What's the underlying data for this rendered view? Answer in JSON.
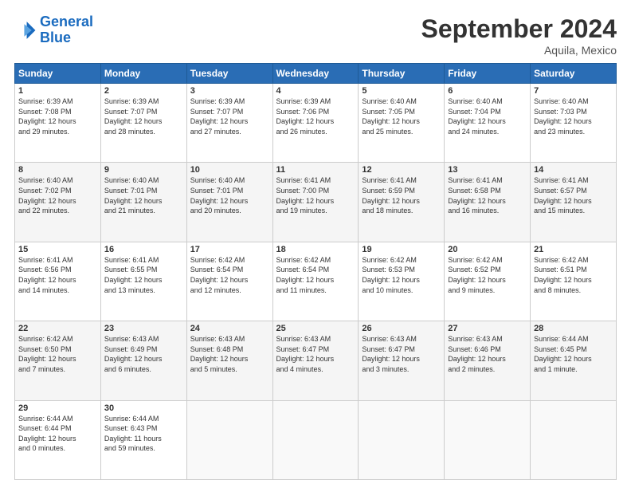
{
  "logo": {
    "line1": "General",
    "line2": "Blue"
  },
  "title": "September 2024",
  "location": "Aquila, Mexico",
  "header_days": [
    "Sunday",
    "Monday",
    "Tuesday",
    "Wednesday",
    "Thursday",
    "Friday",
    "Saturday"
  ],
  "weeks": [
    [
      {
        "num": "1",
        "rise": "6:39 AM",
        "set": "7:08 PM",
        "daylight": "12 hours and 29 minutes."
      },
      {
        "num": "2",
        "rise": "6:39 AM",
        "set": "7:07 PM",
        "daylight": "12 hours and 28 minutes."
      },
      {
        "num": "3",
        "rise": "6:39 AM",
        "set": "7:07 PM",
        "daylight": "12 hours and 27 minutes."
      },
      {
        "num": "4",
        "rise": "6:39 AM",
        "set": "7:06 PM",
        "daylight": "12 hours and 26 minutes."
      },
      {
        "num": "5",
        "rise": "6:40 AM",
        "set": "7:05 PM",
        "daylight": "12 hours and 25 minutes."
      },
      {
        "num": "6",
        "rise": "6:40 AM",
        "set": "7:04 PM",
        "daylight": "12 hours and 24 minutes."
      },
      {
        "num": "7",
        "rise": "6:40 AM",
        "set": "7:03 PM",
        "daylight": "12 hours and 23 minutes."
      }
    ],
    [
      {
        "num": "8",
        "rise": "6:40 AM",
        "set": "7:02 PM",
        "daylight": "12 hours and 22 minutes."
      },
      {
        "num": "9",
        "rise": "6:40 AM",
        "set": "7:01 PM",
        "daylight": "12 hours and 21 minutes."
      },
      {
        "num": "10",
        "rise": "6:40 AM",
        "set": "7:01 PM",
        "daylight": "12 hours and 20 minutes."
      },
      {
        "num": "11",
        "rise": "6:41 AM",
        "set": "7:00 PM",
        "daylight": "12 hours and 19 minutes."
      },
      {
        "num": "12",
        "rise": "6:41 AM",
        "set": "6:59 PM",
        "daylight": "12 hours and 18 minutes."
      },
      {
        "num": "13",
        "rise": "6:41 AM",
        "set": "6:58 PM",
        "daylight": "12 hours and 16 minutes."
      },
      {
        "num": "14",
        "rise": "6:41 AM",
        "set": "6:57 PM",
        "daylight": "12 hours and 15 minutes."
      }
    ],
    [
      {
        "num": "15",
        "rise": "6:41 AM",
        "set": "6:56 PM",
        "daylight": "12 hours and 14 minutes."
      },
      {
        "num": "16",
        "rise": "6:41 AM",
        "set": "6:55 PM",
        "daylight": "12 hours and 13 minutes."
      },
      {
        "num": "17",
        "rise": "6:42 AM",
        "set": "6:54 PM",
        "daylight": "12 hours and 12 minutes."
      },
      {
        "num": "18",
        "rise": "6:42 AM",
        "set": "6:54 PM",
        "daylight": "12 hours and 11 minutes."
      },
      {
        "num": "19",
        "rise": "6:42 AM",
        "set": "6:53 PM",
        "daylight": "12 hours and 10 minutes."
      },
      {
        "num": "20",
        "rise": "6:42 AM",
        "set": "6:52 PM",
        "daylight": "12 hours and 9 minutes."
      },
      {
        "num": "21",
        "rise": "6:42 AM",
        "set": "6:51 PM",
        "daylight": "12 hours and 8 minutes."
      }
    ],
    [
      {
        "num": "22",
        "rise": "6:42 AM",
        "set": "6:50 PM",
        "daylight": "12 hours and 7 minutes."
      },
      {
        "num": "23",
        "rise": "6:43 AM",
        "set": "6:49 PM",
        "daylight": "12 hours and 6 minutes."
      },
      {
        "num": "24",
        "rise": "6:43 AM",
        "set": "6:48 PM",
        "daylight": "12 hours and 5 minutes."
      },
      {
        "num": "25",
        "rise": "6:43 AM",
        "set": "6:47 PM",
        "daylight": "12 hours and 4 minutes."
      },
      {
        "num": "26",
        "rise": "6:43 AM",
        "set": "6:47 PM",
        "daylight": "12 hours and 3 minutes."
      },
      {
        "num": "27",
        "rise": "6:43 AM",
        "set": "6:46 PM",
        "daylight": "12 hours and 2 minutes."
      },
      {
        "num": "28",
        "rise": "6:44 AM",
        "set": "6:45 PM",
        "daylight": "12 hours and 1 minute."
      }
    ],
    [
      {
        "num": "29",
        "rise": "6:44 AM",
        "set": "6:44 PM",
        "daylight": "12 hours and 0 minutes."
      },
      {
        "num": "30",
        "rise": "6:44 AM",
        "set": "6:43 PM",
        "daylight": "11 hours and 59 minutes."
      },
      null,
      null,
      null,
      null,
      null
    ]
  ]
}
